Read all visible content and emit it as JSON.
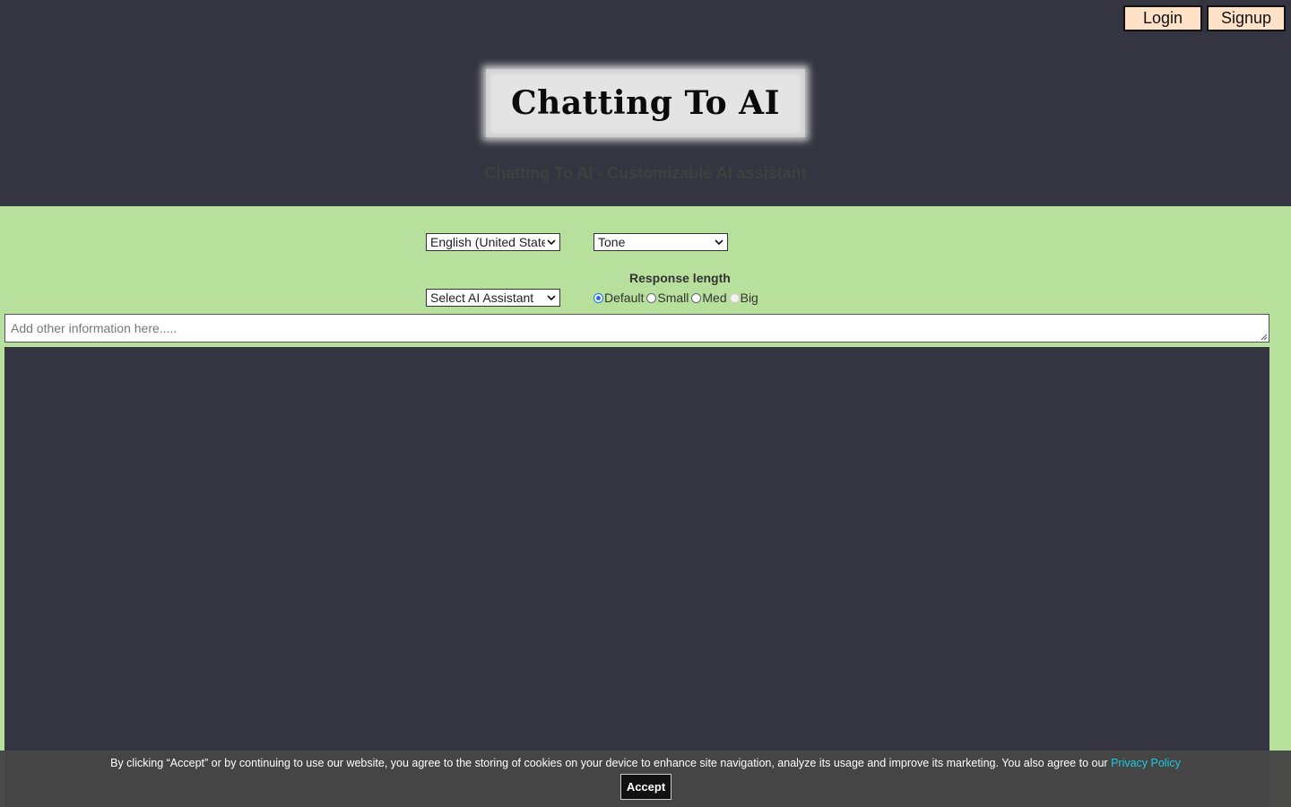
{
  "header": {
    "login_label": "Login",
    "signup_label": "Signup",
    "logo_text": "Chatting To AI",
    "tagline": "Chatting To AI - Customizable AI assistant"
  },
  "controls": {
    "language_select": "English (United States)",
    "tone_select": "Tone",
    "assistant_select": "Select AI Assistant",
    "response_length": {
      "title": "Response length",
      "options": [
        {
          "label": "Default",
          "checked": true,
          "disabled": false
        },
        {
          "label": "Small",
          "checked": false,
          "disabled": false
        },
        {
          "label": "Med",
          "checked": false,
          "disabled": false
        },
        {
          "label": "Big",
          "checked": false,
          "disabled": true
        }
      ]
    },
    "info_placeholder": "Add other information here....."
  },
  "cookie": {
    "text": "By clicking “Accept” or by continuing to use our website, you agree to the storing of cookies on your device to enhance site navigation, analyze its usage and improve its marketing. You also agree to our",
    "link": "Privacy Policy",
    "accept_label": "Accept"
  },
  "colors": {
    "header_bg": "#353541",
    "page_bg": "#b8e09d",
    "auth_button_bg": "#ffe1c8",
    "link": "#21c9df"
  }
}
